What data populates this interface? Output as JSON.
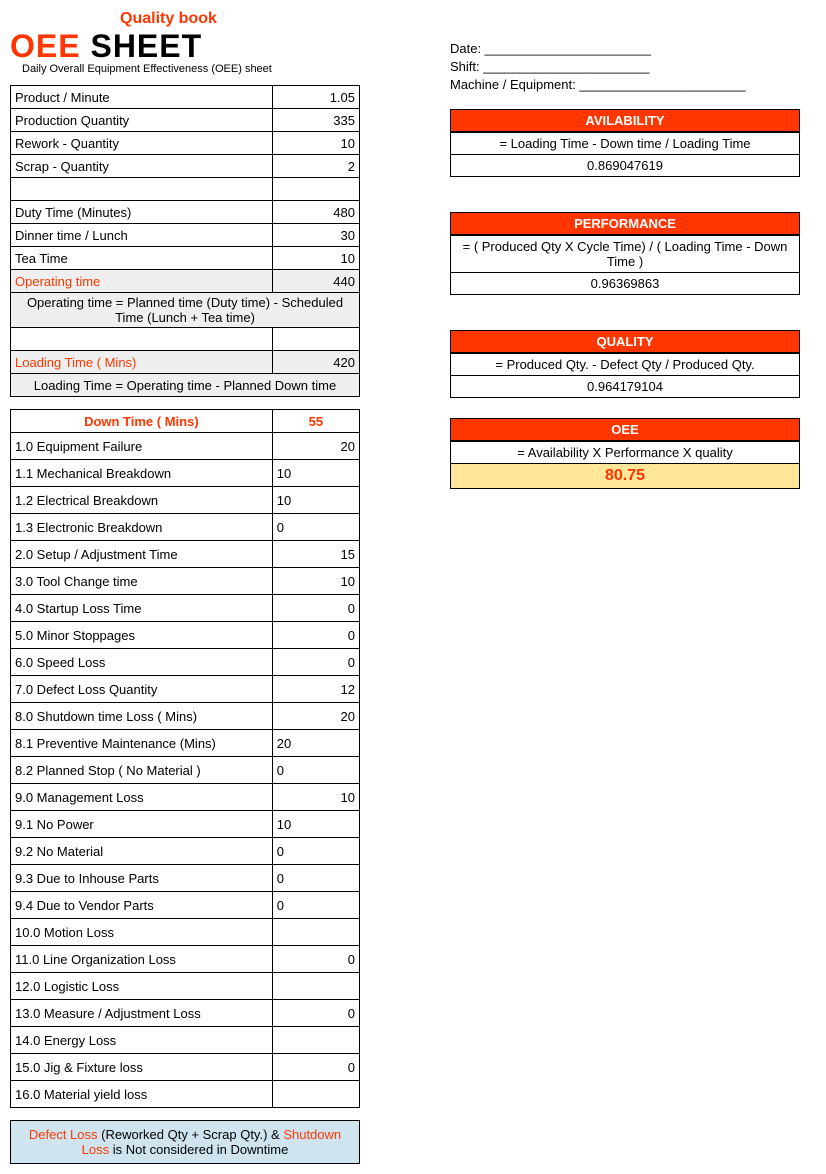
{
  "logo": {
    "top": "Quality book",
    "main1": "OEE",
    "main2": "SHEET",
    "sub": "Daily Overall Equipment Effectiveness (OEE) sheet"
  },
  "meta": {
    "date_label": "Date: _______________________",
    "shift_label": "Shift: _______________________",
    "machine_label": "Machine / Equipment: _______________________"
  },
  "prod": {
    "ppm_label": "Product / Minute",
    "ppm": "1.05",
    "pq_label": "Production Quantity",
    "pq": "335",
    "rw_label": "Rework - Quantity",
    "rw": "10",
    "sc_label": "Scrap - Quantity",
    "sc": "2"
  },
  "time": {
    "duty_label": "Duty Time (Minutes)",
    "duty": "480",
    "lunch_label": "Dinner time / Lunch",
    "lunch": "30",
    "tea_label": "Tea Time",
    "tea": "10",
    "op_label": "Operating time",
    "op": "440",
    "op_formula": "Operating time = Planned time (Duty time) - Scheduled Time (Lunch + Tea time)",
    "load_label": "Loading Time ( Mins)",
    "load": "420",
    "load_formula": "Loading Time = Operating time - Planned Down time"
  },
  "down": {
    "header": "Down Time ( Mins)",
    "total": "55",
    "rows": [
      {
        "l": "1.0 Equipment Failure",
        "v": "20",
        "align": "right"
      },
      {
        "l": "1.1 Mechanical Breakdown",
        "v": "10",
        "align": "left"
      },
      {
        "l": "1.2 Electrical Breakdown",
        "v": "10",
        "align": "left"
      },
      {
        "l": "1.3 Electronic Breakdown",
        "v": "0",
        "align": "left"
      },
      {
        "l": "2.0 Setup / Adjustment Time",
        "v": "15",
        "align": "right"
      },
      {
        "l": "3.0 Tool Change time",
        "v": "10",
        "align": "right"
      },
      {
        "l": "4.0 Startup Loss Time",
        "v": "0",
        "align": "right"
      },
      {
        "l": "5.0 Minor Stoppages",
        "v": "0",
        "align": "right"
      },
      {
        "l": "6.0 Speed Loss",
        "v": "0",
        "align": "right"
      },
      {
        "l": "7.0 Defect Loss Quantity",
        "v": "12",
        "align": "right"
      },
      {
        "l": "8.0 Shutdown time Loss ( Mins)",
        "v": "20",
        "align": "right"
      },
      {
        "l": "8.1 Preventive Maintenance  (Mins)",
        "v": "20",
        "align": "left"
      },
      {
        "l": "8.2 Planned Stop ( No Material )",
        "v": "0",
        "align": "left"
      },
      {
        "l": "9.0 Management Loss",
        "v": "10",
        "align": "right"
      },
      {
        "l": "9.1 No Power",
        "v": "10",
        "align": "left"
      },
      {
        "l": "9.2 No Material",
        "v": "0",
        "align": "left"
      },
      {
        "l": "9.3 Due to Inhouse Parts",
        "v": "0",
        "align": "left"
      },
      {
        "l": "9.4 Due to Vendor Parts",
        "v": "0",
        "align": "left"
      },
      {
        "l": "10.0 Motion Loss",
        "v": "",
        "align": "right"
      },
      {
        "l": "11.0 Line Organization Loss",
        "v": "0",
        "align": "right"
      },
      {
        "l": "12.0 Logistic Loss",
        "v": "",
        "align": "right"
      },
      {
        "l": "13.0 Measure / Adjustment Loss",
        "v": "0",
        "align": "right"
      },
      {
        "l": "14.0 Energy Loss",
        "v": "",
        "align": "right"
      },
      {
        "l": "15.0 Jig & Fixture loss",
        "v": "0",
        "align": "right"
      },
      {
        "l": "16.0 Material yield loss",
        "v": "",
        "align": "right"
      }
    ]
  },
  "footer": {
    "part1": "Defect Loss",
    "part2": " (Reworked Qty + Scrap Qty.) & ",
    "part3": "Shutdown Loss",
    "part4": " is Not considered in Downtime"
  },
  "calc": {
    "avail_title": "AVILABILITY",
    "avail_formula": "= Loading Time - Down time / Loading Time",
    "avail_val": "0.869047619",
    "perf_title": "PERFORMANCE",
    "perf_formula": "= ( Produced Qty  X Cycle Time)  / ( Loading Time - Down Time )",
    "perf_val": "0.96369863",
    "qual_title": "QUALITY",
    "qual_formula": "=  Produced Qty. - Defect Qty / Produced Qty.",
    "qual_val": "0.964179104",
    "oee_title": "OEE",
    "oee_formula": "= Availability X Performance X quality",
    "oee_val": "80.75"
  }
}
